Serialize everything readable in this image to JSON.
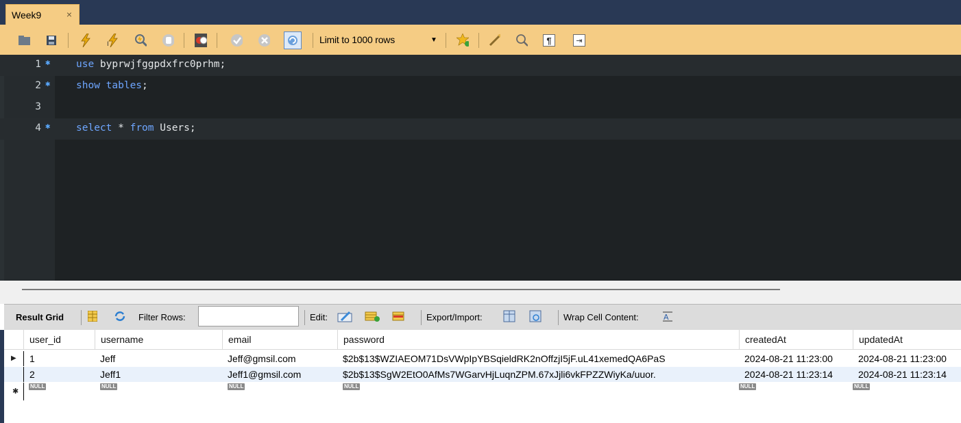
{
  "tab": {
    "title": "Week9",
    "close": "×"
  },
  "toolbar": {
    "limit_label": "Limit to 1000 rows",
    "icons": [
      "open-folder-icon",
      "save-icon",
      "execute-icon",
      "execute-current-icon",
      "explain-icon",
      "stop-icon",
      "toggle-errors-icon",
      "commit-icon",
      "rollback-icon",
      "autocommit-icon",
      "limit-dropdown-arrow",
      "add-snippet-icon",
      "beautify-icon",
      "find-icon",
      "invisible-chars-icon",
      "wrap-lines-icon"
    ]
  },
  "editor": {
    "lines": [
      {
        "num": "1",
        "marker": true,
        "kw": "use",
        "rest": " byprwjfggpdxfrc0prhm;"
      },
      {
        "num": "2",
        "marker": true,
        "kw": "show tables",
        "rest": ";"
      },
      {
        "num": "3",
        "marker": false,
        "kw": "",
        "rest": ""
      },
      {
        "num": "4",
        "marker": true,
        "kw": "select",
        "rest": " * ",
        "kw2": "from",
        "rest2": " Users;"
      }
    ]
  },
  "result_toolbar": {
    "result_grid": "Result Grid",
    "filter_rows": "Filter Rows:",
    "filter_value": "",
    "edit": "Edit:",
    "export_import": "Export/Import:",
    "wrap_cell": "Wrap Cell Content:"
  },
  "grid": {
    "columns": [
      "user_id",
      "username",
      "email",
      "password",
      "createdAt",
      "updatedAt"
    ],
    "rows": [
      [
        "1",
        "Jeff",
        "Jeff@gmsil.com",
        "$2b$13$WZIAEOM71DsVWpIpYBSqieldRK2nOffzjI5jF.uL41xemedQA6PaS",
        "2024-08-21 11:23:00",
        "2024-08-21 11:23:00"
      ],
      [
        "2",
        "Jeff1",
        "Jeff1@gmsil.com",
        "$2b$13$SgW2EtO0AfMs7WGarvHjLuqnZPM.67xJjli6vkFPZZWiyKa/uuor.",
        "2024-08-21 11:23:14",
        "2024-08-21 11:23:14"
      ]
    ],
    "null_label": "NULL",
    "current_row_marker": "▶",
    "new_row_marker": "✱"
  }
}
